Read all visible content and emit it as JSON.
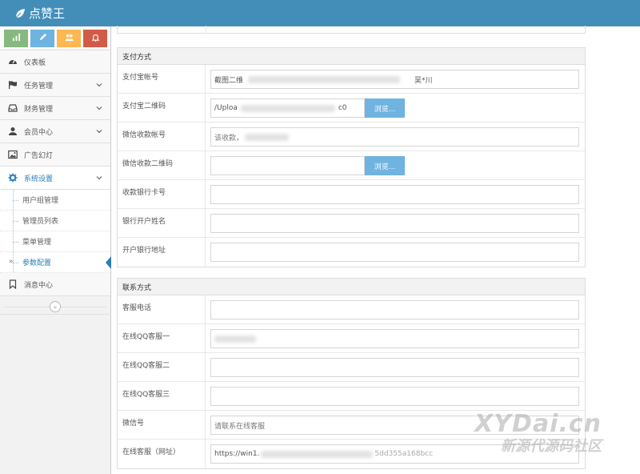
{
  "app": {
    "title": "点赞王"
  },
  "colors": {
    "topbar": "#438eb9",
    "green": "#87b87f",
    "blue": "#6fb3e0",
    "orange": "#ffb752",
    "red": "#d15b47",
    "active": "#2b7dbc"
  },
  "shortcuts": [
    {
      "icon": "signal-icon"
    },
    {
      "icon": "pencil-icon"
    },
    {
      "icon": "users-icon"
    },
    {
      "icon": "bell-icon"
    }
  ],
  "sidebar": {
    "items": [
      {
        "label": "仪表板",
        "icon": "dashboard-icon"
      },
      {
        "label": "任务管理",
        "icon": "flag-icon"
      },
      {
        "label": "财务管理",
        "icon": "inbox-icon"
      },
      {
        "label": "会员中心",
        "icon": "user-icon"
      },
      {
        "label": "广告幻灯",
        "icon": "picture-icon"
      },
      {
        "label": "系统设置",
        "icon": "cogs-icon"
      }
    ],
    "sub_items": [
      {
        "label": "用户组管理"
      },
      {
        "label": "管理员列表"
      },
      {
        "label": "菜单管理"
      },
      {
        "label": "参数配置"
      }
    ],
    "message": {
      "label": "消息中心",
      "icon": "bookmark-icon"
    },
    "collapse": "«"
  },
  "payment": {
    "title": "支付方式",
    "alipay_account": {
      "label": "支付宝帐号",
      "value_start": "截图二维",
      "value_end": "吴*川"
    },
    "alipay_qr": {
      "label": "支付宝二维码",
      "value_start": "/Uploa",
      "value_end": "c0",
      "button": "浏览..."
    },
    "wechat_account": {
      "label": "微信收款帐号",
      "value": "该收款，"
    },
    "wechat_qr": {
      "label": "微信收款二维码",
      "button": "浏览..."
    },
    "bank_card": {
      "label": "收款银行卡号"
    },
    "bank_name": {
      "label": "银行开户姓名"
    },
    "bank_address": {
      "label": "开户银行地址"
    }
  },
  "contact": {
    "title": "联系方式",
    "phone": {
      "label": "客服电话"
    },
    "qq1": {
      "label": "在线QQ客服一"
    },
    "qq2": {
      "label": "在线QQ客服二"
    },
    "qq3": {
      "label": "在线QQ客服三"
    },
    "wechat": {
      "label": "微信号",
      "value": "请联系在线客服"
    },
    "online": {
      "label": "在线客服（网址）",
      "value_start": "https://win1.",
      "value_end": "5dd355a168bcc"
    }
  },
  "watermark": {
    "line1": "XYDai.cn",
    "line2": "新源代源码社区"
  }
}
